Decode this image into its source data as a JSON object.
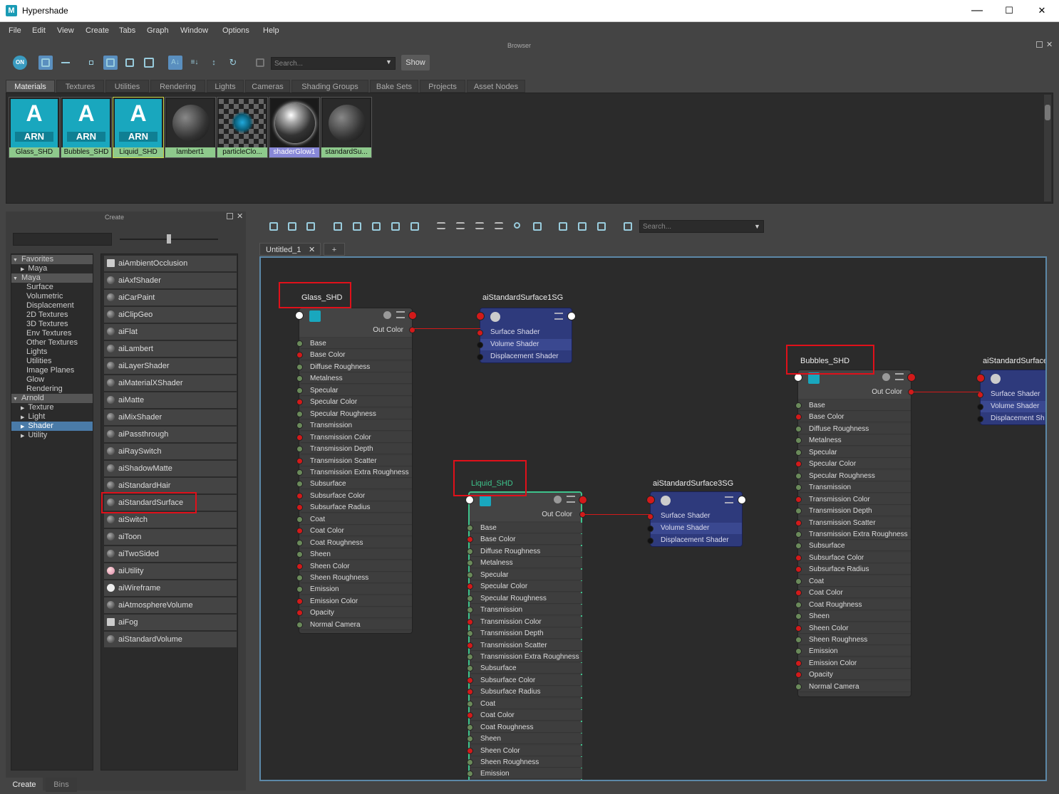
{
  "window": {
    "title": "Hypershade",
    "app_icon": "M",
    "minimize": "—",
    "maximize": "☐",
    "close": "✕"
  },
  "menu": [
    "File",
    "Edit",
    "View",
    "Create",
    "Tabs",
    "Graph",
    "Window",
    "Options",
    "Help"
  ],
  "browser": {
    "header": "Browser",
    "search_placeholder": "Search...",
    "show_label": "Show",
    "on_label": "ON",
    "tabs": [
      "Materials",
      "Textures",
      "Utilities",
      "Rendering",
      "Lights",
      "Cameras",
      "Shading Groups",
      "Bake Sets",
      "Projects",
      "Asset Nodes"
    ],
    "swatches": [
      {
        "name": "Glass_SHD",
        "type": "arn",
        "badge": "ARN",
        "letter": "A"
      },
      {
        "name": "Bubbles_SHD",
        "type": "arn",
        "badge": "ARN",
        "letter": "A"
      },
      {
        "name": "Liquid_SHD",
        "type": "arn",
        "badge": "ARN",
        "letter": "A"
      },
      {
        "name": "lambert1",
        "type": "sphere"
      },
      {
        "name": "particleClo...",
        "type": "checker"
      },
      {
        "name": "shaderGlow1",
        "type": "glow"
      },
      {
        "name": "standardSu...",
        "type": "sphere"
      }
    ]
  },
  "create": {
    "header": "Create",
    "tree": [
      {
        "label": "Favorites",
        "kind": "grp",
        "arrow": "▼"
      },
      {
        "label": "Maya",
        "kind": "child",
        "arrow": "▶"
      },
      {
        "label": "Maya",
        "kind": "grp",
        "arrow": "▼"
      },
      {
        "label": "Surface",
        "kind": "leaf"
      },
      {
        "label": "Volumetric",
        "kind": "leaf"
      },
      {
        "label": "Displacement",
        "kind": "leaf"
      },
      {
        "label": "2D Textures",
        "kind": "leaf"
      },
      {
        "label": "3D Textures",
        "kind": "leaf"
      },
      {
        "label": "Env Textures",
        "kind": "leaf"
      },
      {
        "label": "Other Textures",
        "kind": "leaf"
      },
      {
        "label": "Lights",
        "kind": "leaf"
      },
      {
        "label": "Utilities",
        "kind": "leaf"
      },
      {
        "label": "Image Planes",
        "kind": "leaf"
      },
      {
        "label": "Glow",
        "kind": "leaf"
      },
      {
        "label": "Rendering",
        "kind": "leaf"
      },
      {
        "label": "Arnold",
        "kind": "grp",
        "arrow": "▼"
      },
      {
        "label": "Texture",
        "kind": "child",
        "arrow": "▶"
      },
      {
        "label": "Light",
        "kind": "child",
        "arrow": "▶"
      },
      {
        "label": "Shader",
        "kind": "sel",
        "arrow": "▶"
      },
      {
        "label": "Utility",
        "kind": "child",
        "arrow": "▶"
      }
    ],
    "nodes": [
      "aiAmbientOcclusion",
      "aiAxfShader",
      "aiCarPaint",
      "aiClipGeo",
      "aiFlat",
      "aiLambert",
      "aiLayerShader",
      "aiMaterialXShader",
      "aiMatte",
      "aiMixShader",
      "aiPassthrough",
      "aiRaySwitch",
      "aiShadowMatte",
      "aiStandardHair",
      "aiStandardSurface",
      "aiSwitch",
      "aiToon",
      "aiTwoSided",
      "aiUtility",
      "aiWireframe",
      "aiAtmosphereVolume",
      "aiFog",
      "aiStandardVolume"
    ],
    "bottom_tabs": [
      "Create",
      "Bins"
    ]
  },
  "graph": {
    "search_placeholder": "Search...",
    "tab_label": "Untitled_1",
    "tab_close": "✕",
    "tab_add": "+",
    "out_color": "Out Color",
    "shader_attrs": [
      {
        "n": "Base",
        "c": "g"
      },
      {
        "n": "Base Color",
        "c": "r"
      },
      {
        "n": "Diffuse Roughness",
        "c": "g"
      },
      {
        "n": "Metalness",
        "c": "g"
      },
      {
        "n": "Specular",
        "c": "g"
      },
      {
        "n": "Specular Color",
        "c": "r"
      },
      {
        "n": "Specular Roughness",
        "c": "g"
      },
      {
        "n": "Transmission",
        "c": "g"
      },
      {
        "n": "Transmission Color",
        "c": "r"
      },
      {
        "n": "Transmission Depth",
        "c": "g"
      },
      {
        "n": "Transmission Scatter",
        "c": "r"
      },
      {
        "n": "Transmission Extra Roughness",
        "c": "g"
      },
      {
        "n": "Subsurface",
        "c": "g"
      },
      {
        "n": "Subsurface Color",
        "c": "r"
      },
      {
        "n": "Subsurface Radius",
        "c": "r"
      },
      {
        "n": "Coat",
        "c": "g"
      },
      {
        "n": "Coat Color",
        "c": "r"
      },
      {
        "n": "Coat Roughness",
        "c": "g"
      },
      {
        "n": "Sheen",
        "c": "g"
      },
      {
        "n": "Sheen Color",
        "c": "r"
      },
      {
        "n": "Sheen Roughness",
        "c": "g"
      },
      {
        "n": "Emission",
        "c": "g"
      },
      {
        "n": "Emission Color",
        "c": "r"
      },
      {
        "n": "Opacity",
        "c": "r"
      },
      {
        "n": "Normal Camera",
        "c": "g"
      }
    ],
    "sg_attrs": [
      "Surface Shader",
      "Volume Shader",
      "Displacement Shader"
    ],
    "sg_attrs_clipped": [
      "Surface Shader",
      "Volume Shader",
      "Displacement Sh"
    ],
    "nodes": {
      "glass": {
        "title": "Glass_SHD"
      },
      "sg1": {
        "title": "aiStandardSurface1SG"
      },
      "liquid": {
        "title": "Liquid_SHD"
      },
      "sg3": {
        "title": "aiStandardSurface3SG"
      },
      "bubbles": {
        "title": "Bubbles_SHD"
      },
      "sg2": {
        "title": "aiStandardSurface"
      }
    }
  },
  "colors": {
    "accent": "#4a7ba8",
    "arnold": "#19a7be",
    "port_red": "#d21a1a",
    "sg_blue": "#2e3a7c",
    "highlight": "#e0101a",
    "selected_outline": "#3ec48c"
  }
}
